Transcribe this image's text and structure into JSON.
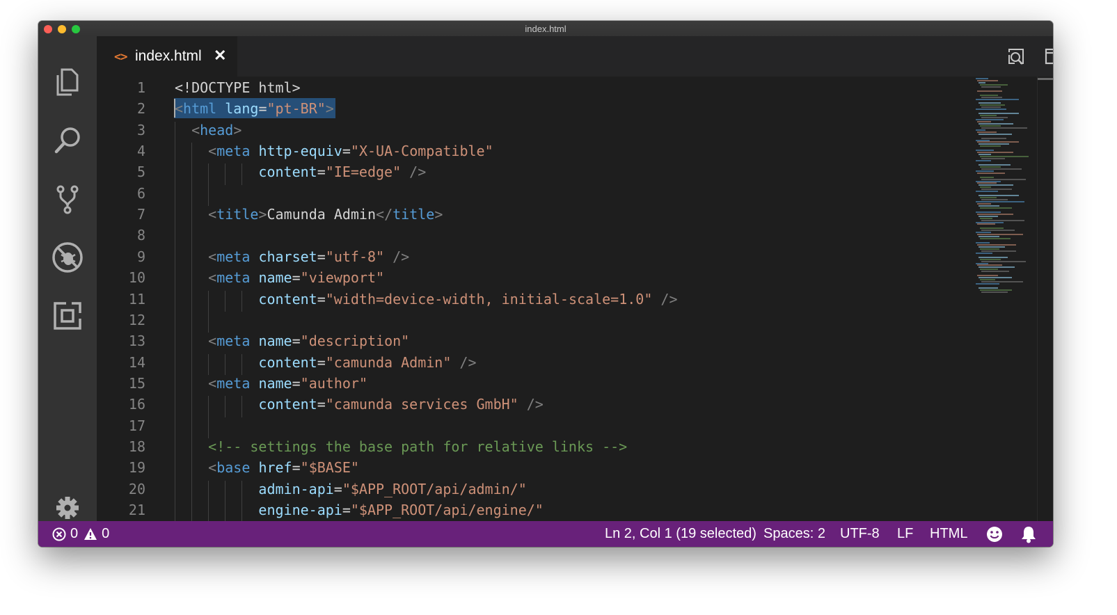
{
  "window": {
    "title": "index.html"
  },
  "activity_bar": {
    "icons": [
      "files-icon",
      "search-icon",
      "source-control-icon",
      "debug-icon",
      "extensions-icon",
      "gear-icon"
    ]
  },
  "tabs": [
    {
      "label": "index.html",
      "icon": "code-icon",
      "close": "✕"
    }
  ],
  "editor_actions": [
    "open-preview-icon",
    "split-editor-icon",
    "more-actions-icon"
  ],
  "editor": {
    "line_numbers": [
      "1",
      "2",
      "3",
      "4",
      "5",
      "6",
      "7",
      "8",
      "9",
      "10",
      "11",
      "12",
      "13",
      "14",
      "15",
      "16",
      "17",
      "18",
      "19",
      "20",
      "21"
    ],
    "lines": [
      [
        {
          "t": "<!DOCTYPE html>",
          "c": "txt"
        }
      ],
      [
        {
          "t": "<",
          "c": "br"
        },
        {
          "t": "html",
          "c": "tag"
        },
        {
          "t": " ",
          "c": "txt"
        },
        {
          "t": "lang",
          "c": "attr"
        },
        {
          "t": "=",
          "c": "txt"
        },
        {
          "t": "\"pt-BR\"",
          "c": "str"
        },
        {
          "t": ">",
          "c": "br"
        }
      ],
      [
        {
          "t": "  ",
          "c": "txt"
        },
        {
          "t": "<",
          "c": "br"
        },
        {
          "t": "head",
          "c": "tag"
        },
        {
          "t": ">",
          "c": "br"
        }
      ],
      [
        {
          "t": "    ",
          "c": "txt"
        },
        {
          "t": "<",
          "c": "br"
        },
        {
          "t": "meta",
          "c": "tag"
        },
        {
          "t": " ",
          "c": "txt"
        },
        {
          "t": "http-equiv",
          "c": "attr"
        },
        {
          "t": "=",
          "c": "txt"
        },
        {
          "t": "\"X-UA-Compatible\"",
          "c": "str"
        }
      ],
      [
        {
          "t": "          ",
          "c": "txt"
        },
        {
          "t": "content",
          "c": "attr"
        },
        {
          "t": "=",
          "c": "txt"
        },
        {
          "t": "\"IE=edge\"",
          "c": "str"
        },
        {
          "t": " />",
          "c": "br"
        }
      ],
      [],
      [
        {
          "t": "    ",
          "c": "txt"
        },
        {
          "t": "<",
          "c": "br"
        },
        {
          "t": "title",
          "c": "tag"
        },
        {
          "t": ">",
          "c": "br"
        },
        {
          "t": "Camunda Admin",
          "c": "txt"
        },
        {
          "t": "</",
          "c": "br"
        },
        {
          "t": "title",
          "c": "tag"
        },
        {
          "t": ">",
          "c": "br"
        }
      ],
      [],
      [
        {
          "t": "    ",
          "c": "txt"
        },
        {
          "t": "<",
          "c": "br"
        },
        {
          "t": "meta",
          "c": "tag"
        },
        {
          "t": " ",
          "c": "txt"
        },
        {
          "t": "charset",
          "c": "attr"
        },
        {
          "t": "=",
          "c": "txt"
        },
        {
          "t": "\"utf-8\"",
          "c": "str"
        },
        {
          "t": " />",
          "c": "br"
        }
      ],
      [
        {
          "t": "    ",
          "c": "txt"
        },
        {
          "t": "<",
          "c": "br"
        },
        {
          "t": "meta",
          "c": "tag"
        },
        {
          "t": " ",
          "c": "txt"
        },
        {
          "t": "name",
          "c": "attr"
        },
        {
          "t": "=",
          "c": "txt"
        },
        {
          "t": "\"viewport\"",
          "c": "str"
        }
      ],
      [
        {
          "t": "          ",
          "c": "txt"
        },
        {
          "t": "content",
          "c": "attr"
        },
        {
          "t": "=",
          "c": "txt"
        },
        {
          "t": "\"width=device-width, initial-scale=1.0\"",
          "c": "str"
        },
        {
          "t": " />",
          "c": "br"
        }
      ],
      [],
      [
        {
          "t": "    ",
          "c": "txt"
        },
        {
          "t": "<",
          "c": "br"
        },
        {
          "t": "meta",
          "c": "tag"
        },
        {
          "t": " ",
          "c": "txt"
        },
        {
          "t": "name",
          "c": "attr"
        },
        {
          "t": "=",
          "c": "txt"
        },
        {
          "t": "\"description\"",
          "c": "str"
        }
      ],
      [
        {
          "t": "          ",
          "c": "txt"
        },
        {
          "t": "content",
          "c": "attr"
        },
        {
          "t": "=",
          "c": "txt"
        },
        {
          "t": "\"camunda Admin\"",
          "c": "str"
        },
        {
          "t": " />",
          "c": "br"
        }
      ],
      [
        {
          "t": "    ",
          "c": "txt"
        },
        {
          "t": "<",
          "c": "br"
        },
        {
          "t": "meta",
          "c": "tag"
        },
        {
          "t": " ",
          "c": "txt"
        },
        {
          "t": "name",
          "c": "attr"
        },
        {
          "t": "=",
          "c": "txt"
        },
        {
          "t": "\"author\"",
          "c": "str"
        }
      ],
      [
        {
          "t": "          ",
          "c": "txt"
        },
        {
          "t": "content",
          "c": "attr"
        },
        {
          "t": "=",
          "c": "txt"
        },
        {
          "t": "\"camunda services GmbH\"",
          "c": "str"
        },
        {
          "t": " />",
          "c": "br"
        }
      ],
      [],
      [
        {
          "t": "    ",
          "c": "txt"
        },
        {
          "t": "<!-- settings the base path for relative links -->",
          "c": "cm"
        }
      ],
      [
        {
          "t": "    ",
          "c": "txt"
        },
        {
          "t": "<",
          "c": "br"
        },
        {
          "t": "base",
          "c": "tag"
        },
        {
          "t": " ",
          "c": "txt"
        },
        {
          "t": "href",
          "c": "attr"
        },
        {
          "t": "=",
          "c": "txt"
        },
        {
          "t": "\"$BASE\"",
          "c": "str"
        }
      ],
      [
        {
          "t": "          ",
          "c": "txt"
        },
        {
          "t": "admin-api",
          "c": "attr"
        },
        {
          "t": "=",
          "c": "txt"
        },
        {
          "t": "\"$APP_ROOT/api/admin/\"",
          "c": "str"
        }
      ],
      [
        {
          "t": "          ",
          "c": "txt"
        },
        {
          "t": "engine-api",
          "c": "attr"
        },
        {
          "t": "=",
          "c": "txt"
        },
        {
          "t": "\"$APP_ROOT/api/engine/\"",
          "c": "str"
        }
      ]
    ]
  },
  "status_bar": {
    "errors": "0",
    "warnings": "0",
    "cursor": "Ln 2, Col 1 (19 selected)",
    "spaces": "Spaces: 2",
    "encoding": "UTF-8",
    "eol": "LF",
    "language": "HTML",
    "feedback_icon": "smiley-icon",
    "notifications_icon": "bell-icon"
  },
  "colors": {
    "status_bar": "#68217a",
    "editor_bg": "#1e1e1e",
    "activity_bar": "#333333",
    "tag": "#569cd6",
    "attribute": "#9cdcfe",
    "string": "#ce9178",
    "comment": "#6a9955"
  }
}
